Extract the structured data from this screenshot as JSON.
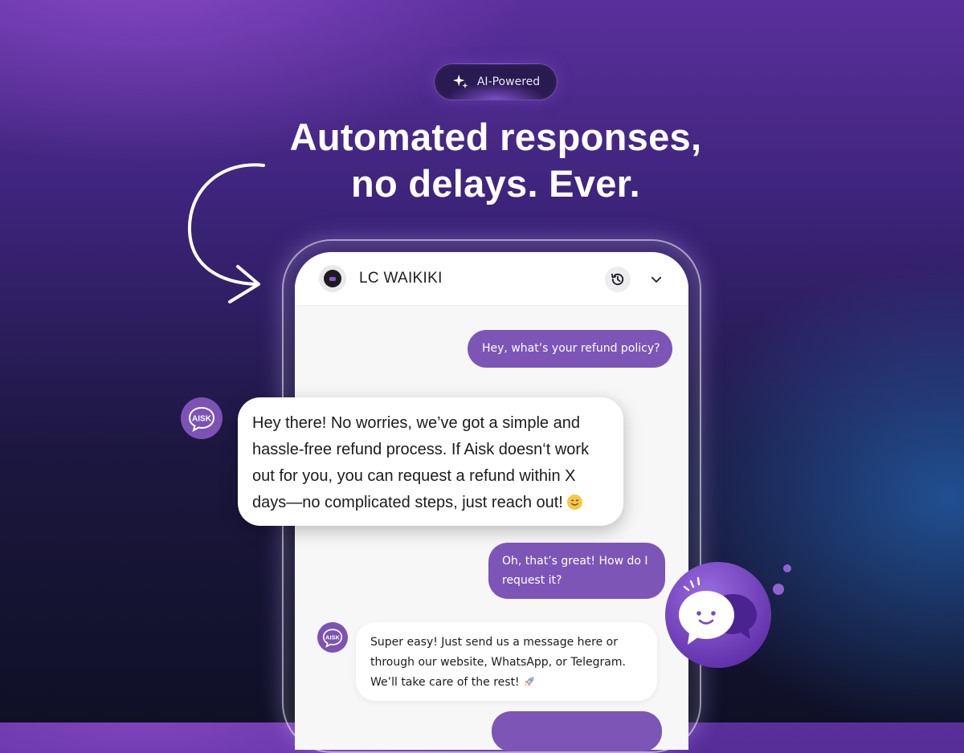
{
  "badge": {
    "label": "AI-Powered",
    "icon": "sparkle-icon"
  },
  "headline": {
    "line1": "Automated responses,",
    "line2": "no delays. Ever."
  },
  "chat": {
    "brand_name": "LC WAIKIKI",
    "history_icon": "history-icon",
    "collapse_icon": "chevron-down-icon",
    "messages": [
      {
        "sender": "user",
        "text": "Hey, what’s your refund policy?"
      },
      {
        "sender": "bot",
        "text": "Hey there! No worries, we’ve got a simple and hassle-free refund process. If Aisk doesn‘t work out for you, you can request a refund within X days—no complicated steps, just reach out!",
        "emoji": "😊"
      },
      {
        "sender": "user",
        "text": "Oh, that’s great! How do I request it?"
      },
      {
        "sender": "bot",
        "text": " Super easy! Just send us a message here or through our website, WhatsApp, or Telegram. We’ll take care of the rest!",
        "emoji": "🚀"
      }
    ]
  },
  "avatar_label": "AISK",
  "colors": {
    "accent": "#7d55b6",
    "bubble_bot": "#ffffff",
    "screen_bg": "#f7f7f8",
    "headline": "#ffffff"
  }
}
